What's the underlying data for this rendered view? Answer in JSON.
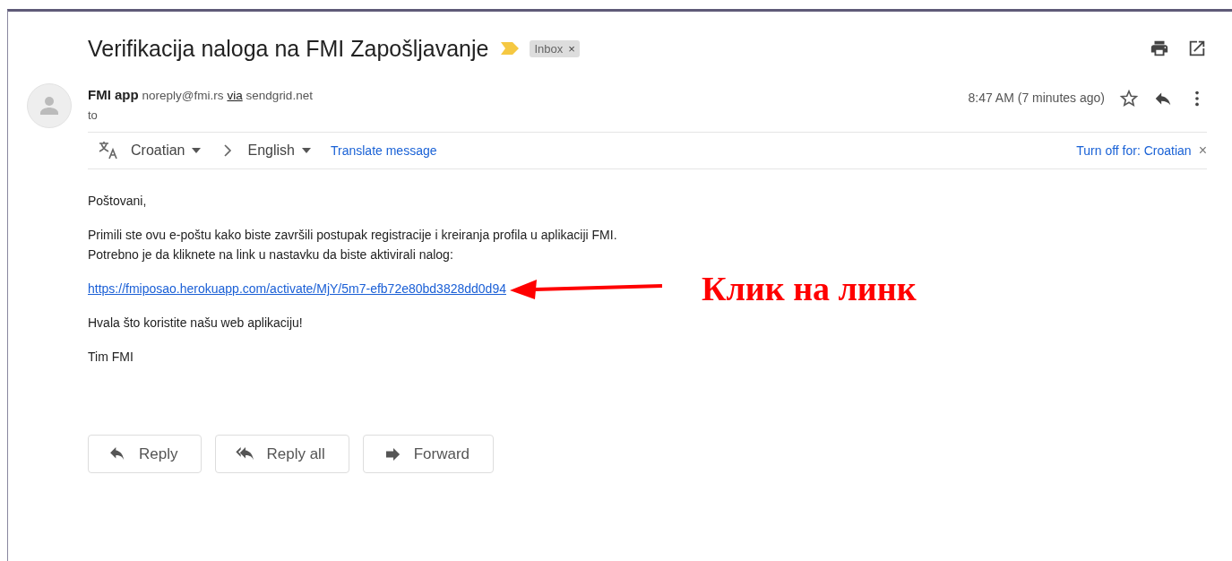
{
  "subject": "Verifikacija naloga na FMI Zapošljavanje",
  "label": {
    "text": "Inbox",
    "close": "×"
  },
  "sender": {
    "name": "FMI app",
    "email": "noreply@fmi.rs",
    "via": "via",
    "domain": "sendgrid.net",
    "to": "to"
  },
  "time": "8:47 AM (7 minutes ago)",
  "translate": {
    "from": "Croatian",
    "to": "English",
    "action": "Translate message",
    "turn_off": "Turn off for: Croatian",
    "close": "×"
  },
  "body": [
    "Poštovani,",
    "Primili ste ovu e-poštu kako biste završili postupak registracije i kreiranja profila u aplikaciji FMI.\nPotrebno je da kliknete na link u nastavku da biste aktivirali nalog:"
  ],
  "link": "https://fmiposao.herokuapp.com/activate/MjY/5m7-efb72e80bd3828dd0d94",
  "annotation": "Клик на линк",
  "closing": [
    "Hvala što koristite našu web aplikaciju!",
    "Tim FMI"
  ],
  "buttons": [
    {
      "kind": "reply",
      "label": "Reply"
    },
    {
      "kind": "reply_all",
      "label": "Reply all"
    },
    {
      "kind": "forward",
      "label": "Forward"
    }
  ]
}
